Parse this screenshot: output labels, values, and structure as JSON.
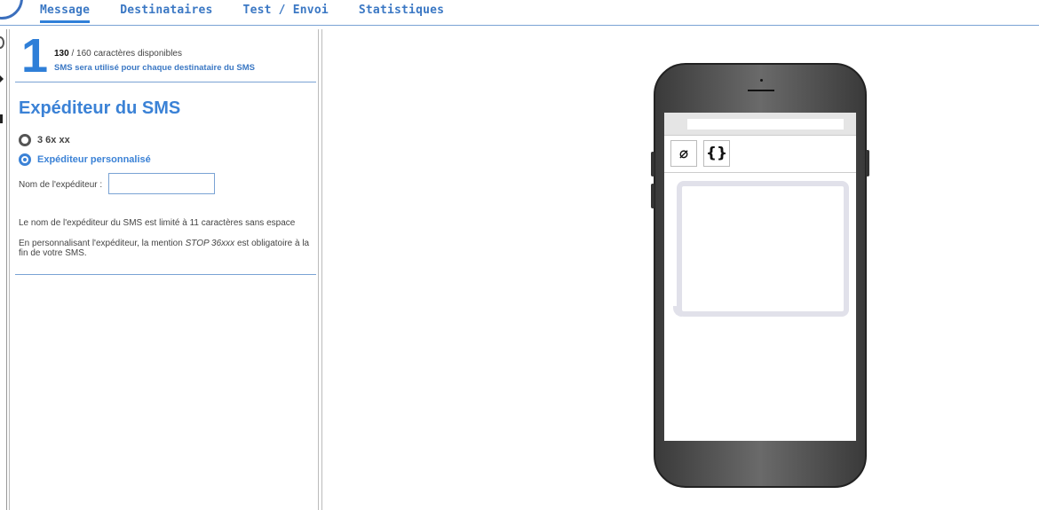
{
  "nav": {
    "tabs": [
      {
        "label": "Message",
        "active": true
      },
      {
        "label": "Destinataires",
        "active": false
      },
      {
        "label": "Test / Envoi",
        "active": false
      },
      {
        "label": "Statistiques",
        "active": false
      }
    ]
  },
  "step": {
    "number": "1",
    "chars_available": "130",
    "chars_total": " / 160 caractères disponibles",
    "sms_info": "SMS sera utilisé pour chaque destinataire du SMS"
  },
  "sender": {
    "title": "Expéditeur du SMS",
    "option_default": "3 6x xx",
    "option_custom": "Expéditeur personnalisé",
    "selected": "custom",
    "name_label": "Nom de l'expéditeur :",
    "name_value": "",
    "note_limit": "Le nom de l'expéditeur du SMS est limité à 11 caractères sans espace",
    "note_stop_prefix": "En personnalisant l'expéditeur, la mention ",
    "note_stop_mention": "STOP 36xxx",
    "note_stop_suffix": " est obligatoire à la fin de votre SMS."
  },
  "phone": {
    "tools": [
      {
        "name": "unlink-icon",
        "glyph": "⌀"
      },
      {
        "name": "braces-icon",
        "glyph": "{}"
      }
    ],
    "message": ""
  },
  "colors": {
    "accent": "#3b82d6",
    "divider": "#7aa3d4"
  }
}
